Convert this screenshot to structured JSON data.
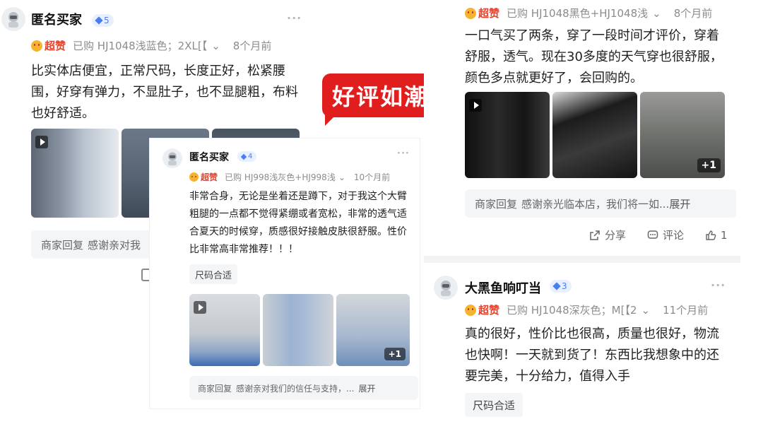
{
  "badge": {
    "label": "好评如潮"
  },
  "review_left": {
    "username": "匿名买家",
    "level": "5",
    "rating_label": "超赞",
    "purchase": "已购 HJ1048浅蓝色；2XL[【",
    "time": "8个月前",
    "text": "比实体店便宜，正常尺码，长度正好，松紧腰围，好穿有弹力，不显肚子，也不显腿粗，布料也好舒适。",
    "reply_label": "商家回复",
    "reply_text": "感谢亲对我"
  },
  "review_middle": {
    "username": "匿名买家",
    "level": "4",
    "rating_label": "超赞",
    "purchase": "已购 HJ998浅灰色+HJ998浅",
    "time": "10个月前",
    "text": "非常合身，无论是坐着还是蹲下，对于我这个大臂粗腿的一点都不觉得紧绷或者宽松，非常的透气适合夏天的时候穿，质感很好接触皮肤很舒服。性价比非常高非常推荐！！！",
    "tag": "尺码合适",
    "more_photos": "+1",
    "reply_label": "商家回复",
    "reply_text": "感谢亲对我们的信任与支持，...",
    "expand": "展开"
  },
  "review_right_top": {
    "rating_label": "超赞",
    "purchase": "已购 HJ1048黑色+HJ1048浅",
    "time": "8个月前",
    "text": "一口气买了两条，穿了一段时间才评价，穿着舒服，透气。现在30多度的天气穿也很舒服，颜色多点就更好了，会回购的。",
    "more_photos": "+1",
    "reply_label": "商家回复",
    "reply_text": "感谢亲光临本店，我们将一如...",
    "expand": "展开",
    "share": "分享",
    "comment": "评论",
    "likes": "1"
  },
  "review_right_bottom": {
    "username": "大黑鱼响叮当",
    "level": "3",
    "rating_label": "超赞",
    "purchase": "已购 HJ1048深灰色；M[【2",
    "time": "11个月前",
    "text": "真的很好，性价比也很高，质量也很好，物流也快啊！一天就到货了！东西比我想象中的还要完美，十分给力，值得入手",
    "tag": "尺码合适"
  },
  "colors": {
    "badge_red": "#e01e1e",
    "rating_red": "#e2442f",
    "level_blue": "#4a7df0",
    "muted": "#8c8c8c",
    "panel_bg": "#f4f5f7"
  },
  "icons": [
    "avatar-robot",
    "level-gem-icon",
    "more-dots-icon",
    "rating-face-icon",
    "chevron-down-icon",
    "play-icon",
    "share-icon",
    "comment-icon",
    "like-icon"
  ]
}
